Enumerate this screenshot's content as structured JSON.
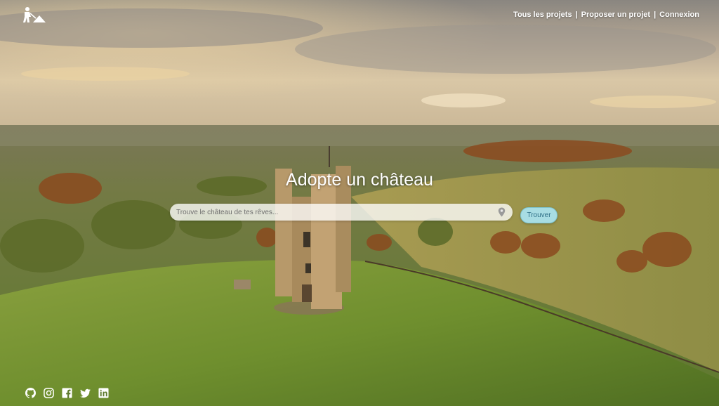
{
  "nav": {
    "links": [
      "Tous les projets",
      "Proposer un projet",
      "Connexion"
    ],
    "separator": "|"
  },
  "hero": {
    "title": "Adopte un château"
  },
  "search": {
    "placeholder": "Trouve le château de tes rêves...",
    "value": "",
    "button_label": "Trouver",
    "icon": "map-pin-icon"
  },
  "logo": {
    "icon": "worker-shovel-icon"
  },
  "socials": [
    {
      "name": "github",
      "icon": "github-icon"
    },
    {
      "name": "instagram",
      "icon": "instagram-icon"
    },
    {
      "name": "facebook",
      "icon": "facebook-icon"
    },
    {
      "name": "twitter",
      "icon": "twitter-icon"
    },
    {
      "name": "linkedin",
      "icon": "linkedin-icon"
    }
  ],
  "colors": {
    "button_bg": "#a8dde3",
    "button_text": "#2f6f86",
    "text": "#ffffff"
  }
}
